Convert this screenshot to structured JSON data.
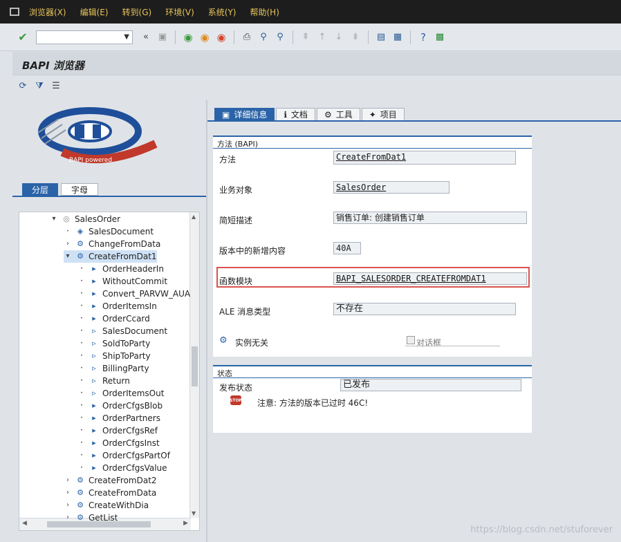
{
  "menubar": {
    "items": [
      "浏览器(X)",
      "编辑(E)",
      "转到(G)",
      "环境(V)",
      "系统(Y)",
      "帮助(H)"
    ]
  },
  "toolbar": {
    "command_field_value": ""
  },
  "page": {
    "title": "BAPI 浏览器"
  },
  "left_tabs": {
    "tab1": "分层",
    "tab2": "字母"
  },
  "tree": {
    "nodes": [
      {
        "label": "SalesOrder",
        "level": 0,
        "expanded": true,
        "icon": "object-icon"
      },
      {
        "label": "SalesDocument",
        "level": 1,
        "icon": "tag-icon"
      },
      {
        "label": "ChangeFromData",
        "level": 1,
        "expandable": true,
        "icon": "method-icon"
      },
      {
        "label": "CreateFromDat1",
        "level": 1,
        "expanded": true,
        "selected": true,
        "icon": "method-icon"
      },
      {
        "label": "OrderHeaderIn",
        "level": 2,
        "icon": "param-in-icon"
      },
      {
        "label": "WithoutCommit",
        "level": 2,
        "icon": "param-in-icon"
      },
      {
        "label": "Convert_PARVW_AUA",
        "level": 2,
        "icon": "param-in-icon"
      },
      {
        "label": "OrderItemsIn",
        "level": 2,
        "icon": "param-in-icon"
      },
      {
        "label": "OrderCcard",
        "level": 2,
        "icon": "param-in-icon"
      },
      {
        "label": "SalesDocument",
        "level": 2,
        "icon": "param-out-icon"
      },
      {
        "label": "SoldToParty",
        "level": 2,
        "icon": "param-out-icon"
      },
      {
        "label": "ShipToParty",
        "level": 2,
        "icon": "param-out-icon"
      },
      {
        "label": "BillingParty",
        "level": 2,
        "icon": "param-out-icon"
      },
      {
        "label": "Return",
        "level": 2,
        "icon": "param-out-icon"
      },
      {
        "label": "OrderItemsOut",
        "level": 2,
        "icon": "param-out-icon"
      },
      {
        "label": "OrderCfgsBlob",
        "level": 2,
        "icon": "param-table-icon"
      },
      {
        "label": "OrderPartners",
        "level": 2,
        "icon": "param-table-icon"
      },
      {
        "label": "OrderCfgsRef",
        "level": 2,
        "icon": "param-table-icon"
      },
      {
        "label": "OrderCfgsInst",
        "level": 2,
        "icon": "param-table-icon"
      },
      {
        "label": "OrderCfgsPartOf",
        "level": 2,
        "icon": "param-table-icon"
      },
      {
        "label": "OrderCfgsValue",
        "level": 2,
        "icon": "param-table-icon"
      },
      {
        "label": "CreateFromDat2",
        "level": 1,
        "expandable": true,
        "icon": "method-icon"
      },
      {
        "label": "CreateFromData",
        "level": 1,
        "expandable": true,
        "icon": "method-icon"
      },
      {
        "label": "CreateWithDia",
        "level": 1,
        "expandable": true,
        "icon": "method-icon"
      },
      {
        "label": "GetList",
        "level": 1,
        "expandable": true,
        "icon": "method-icon"
      }
    ]
  },
  "right_tabs": {
    "detail": "详细信息",
    "docs": "文档",
    "tools": "工具",
    "project": "项目"
  },
  "method_group": {
    "title": "方法 (BAPI)",
    "method_label": "方法",
    "method_value": "CreateFromDat1",
    "object_label": "业务对象",
    "object_value": "SalesOrder",
    "desc_label": "简短描述",
    "desc_value": "销售订单: 创建销售订单",
    "release_label": "版本中的新增内容",
    "release_value": "40A",
    "fm_label": "函数模块",
    "fm_value": "BAPI_SALESORDER_CREATEFROMDAT1",
    "ale_label": "ALE 消息类型",
    "ale_value": "不存在",
    "instance_label": "实例无关",
    "dialog_label": "对话框"
  },
  "status_group": {
    "title": "状态",
    "release_status_label": "发布状态",
    "release_status_value": "已发布",
    "note": "注意: 方法的版本已过时 46C!"
  },
  "watermark": "https://blog.csdn.net/stuforever"
}
